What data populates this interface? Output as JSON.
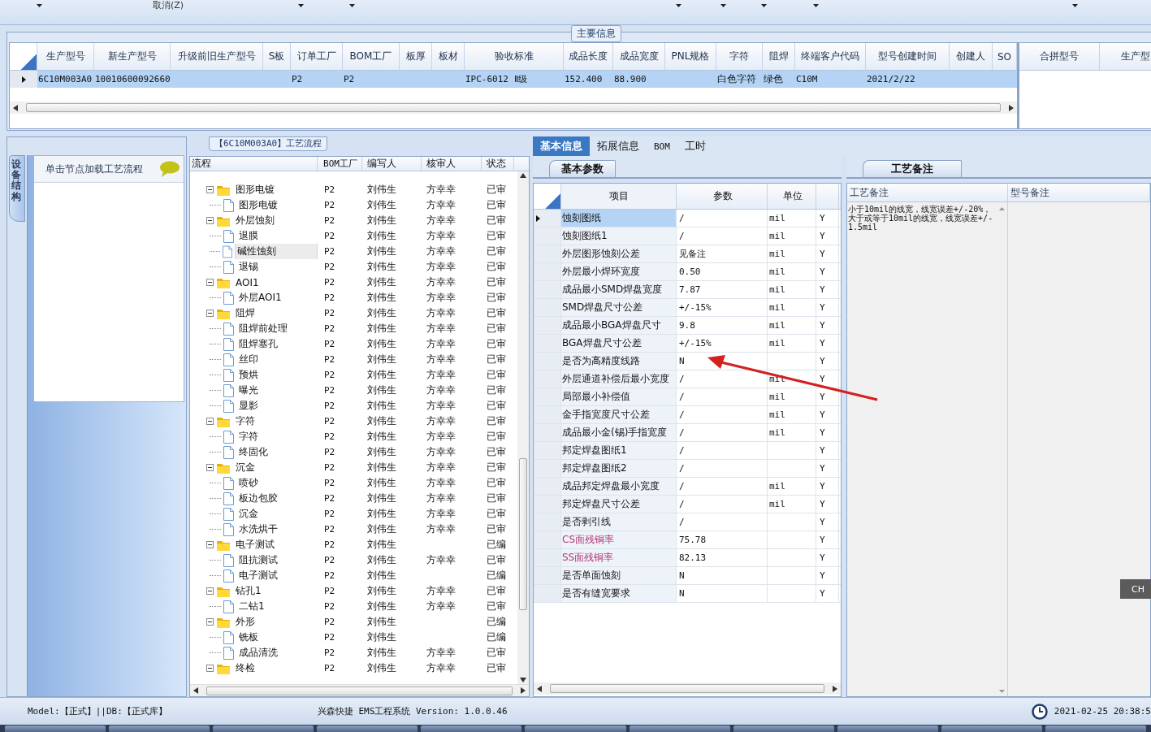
{
  "toolbar": {
    "items": [
      {
        "label": "取消(Z)"
      }
    ]
  },
  "main_info": {
    "title": "主要信息",
    "columns": [
      "生产型号",
      "新生产型号",
      "升级前旧生产型号",
      "S板",
      "订单工厂",
      "BOM工厂",
      "板厚",
      "板材",
      "验收标准",
      "成品长度",
      "成品宽度",
      "PNL规格",
      "字符",
      "阻焊",
      "终端客户代码",
      "型号创建时间",
      "创建人",
      "SO"
    ],
    "rows": [
      {
        "selected": true,
        "cells": [
          "6C10M003A0",
          "10010600092660",
          null,
          null,
          "P2",
          "P2",
          null,
          null,
          "IPC-6012 Ⅱ级",
          "152.400",
          "88.900",
          null,
          "白色字符",
          "绿色",
          "C10M",
          "2021/2/22",
          null,
          null
        ]
      }
    ],
    "side_columns": [
      "合拼型号",
      "生产型"
    ]
  },
  "left_panel": {
    "tab": "设备结构",
    "hint": "单击节点加载工艺流程"
  },
  "process": {
    "title": "【6C10M003A0】工艺流程",
    "columns": [
      "流程",
      "BOM工厂",
      "编写人",
      "核审人",
      "状态"
    ],
    "nodes": [
      {
        "label": "图形电镀",
        "bom": "P2",
        "author": "刘伟生",
        "reviewer": "方幸幸",
        "status": "已审",
        "selected": false,
        "expanded": true,
        "children": [
          {
            "label": "图形电镀",
            "bom": "P2",
            "author": "刘伟生",
            "reviewer": "方幸幸",
            "status": "已审",
            "selected": false
          }
        ]
      },
      {
        "label": "外层蚀刻",
        "bom": "P2",
        "author": "刘伟生",
        "reviewer": "方幸幸",
        "status": "已审",
        "selected": false,
        "expanded": true,
        "children": [
          {
            "label": "退膜",
            "bom": "P2",
            "author": "刘伟生",
            "reviewer": "方幸幸",
            "status": "已审",
            "selected": false
          },
          {
            "label": "碱性蚀刻",
            "bom": "P2",
            "author": "刘伟生",
            "reviewer": "方幸幸",
            "status": "已审",
            "selected": true
          },
          {
            "label": "退锡",
            "bom": "P2",
            "author": "刘伟生",
            "reviewer": "方幸幸",
            "status": "已审",
            "selected": false
          }
        ]
      },
      {
        "label": "AOI1",
        "bom": "P2",
        "author": "刘伟生",
        "reviewer": "方幸幸",
        "status": "已审",
        "selected": false,
        "expanded": true,
        "children": [
          {
            "label": "外层AOI1",
            "bom": "P2",
            "author": "刘伟生",
            "reviewer": "方幸幸",
            "status": "已审",
            "selected": false
          }
        ]
      },
      {
        "label": "阻焊",
        "bom": "P2",
        "author": "刘伟生",
        "reviewer": "方幸幸",
        "status": "已审",
        "selected": false,
        "expanded": true,
        "children": [
          {
            "label": "阻焊前处理",
            "bom": "P2",
            "author": "刘伟生",
            "reviewer": "方幸幸",
            "status": "已审",
            "selected": false
          },
          {
            "label": "阻焊塞孔",
            "bom": "P2",
            "author": "刘伟生",
            "reviewer": "方幸幸",
            "status": "已审",
            "selected": false
          },
          {
            "label": "丝印",
            "bom": "P2",
            "author": "刘伟生",
            "reviewer": "方幸幸",
            "status": "已审",
            "selected": false
          },
          {
            "label": "预烘",
            "bom": "P2",
            "author": "刘伟生",
            "reviewer": "方幸幸",
            "status": "已审",
            "selected": false
          },
          {
            "label": "曝光",
            "bom": "P2",
            "author": "刘伟生",
            "reviewer": "方幸幸",
            "status": "已审",
            "selected": false
          },
          {
            "label": "显影",
            "bom": "P2",
            "author": "刘伟生",
            "reviewer": "方幸幸",
            "status": "已审",
            "selected": false
          }
        ]
      },
      {
        "label": "字符",
        "bom": "P2",
        "author": "刘伟生",
        "reviewer": "方幸幸",
        "status": "已审",
        "selected": false,
        "expanded": true,
        "children": [
          {
            "label": "字符",
            "bom": "P2",
            "author": "刘伟生",
            "reviewer": "方幸幸",
            "status": "已审",
            "selected": false
          },
          {
            "label": "终固化",
            "bom": "P2",
            "author": "刘伟生",
            "reviewer": "方幸幸",
            "status": "已审",
            "selected": false
          }
        ]
      },
      {
        "label": "沉金",
        "bom": "P2",
        "author": "刘伟生",
        "reviewer": "方幸幸",
        "status": "已审",
        "selected": false,
        "expanded": true,
        "children": [
          {
            "label": "喷砂",
            "bom": "P2",
            "author": "刘伟生",
            "reviewer": "方幸幸",
            "status": "已审",
            "selected": false
          },
          {
            "label": "板边包胶",
            "bom": "P2",
            "author": "刘伟生",
            "reviewer": "方幸幸",
            "status": "已审",
            "selected": false
          },
          {
            "label": "沉金",
            "bom": "P2",
            "author": "刘伟生",
            "reviewer": "方幸幸",
            "status": "已审",
            "selected": false
          },
          {
            "label": "水洗烘干",
            "bom": "P2",
            "author": "刘伟生",
            "reviewer": "方幸幸",
            "status": "已审",
            "selected": false
          }
        ]
      },
      {
        "label": "电子测试",
        "bom": "P2",
        "author": "刘伟生",
        "status": "已编",
        "selected": false,
        "expanded": true,
        "children": [
          {
            "label": "阻抗测试",
            "bom": "P2",
            "author": "刘伟生",
            "reviewer": "方幸幸",
            "status": "已审",
            "selected": false
          },
          {
            "label": "电子测试",
            "bom": "P2",
            "author": "刘伟生",
            "status": "已编",
            "selected": false
          }
        ]
      },
      {
        "label": "钻孔1",
        "bom": "P2",
        "author": "刘伟生",
        "reviewer": "方幸幸",
        "status": "已审",
        "selected": false,
        "expanded": true,
        "children": [
          {
            "label": "二钻1",
            "bom": "P2",
            "author": "刘伟生",
            "reviewer": "方幸幸",
            "status": "已审",
            "selected": false
          }
        ]
      },
      {
        "label": "外形",
        "bom": "P2",
        "author": "刘伟生",
        "status": "已编",
        "selected": false,
        "expanded": true,
        "children": [
          {
            "label": "铣板",
            "bom": "P2",
            "author": "刘伟生",
            "status": "已编",
            "selected": false
          },
          {
            "label": "成品清洗",
            "bom": "P2",
            "author": "刘伟生",
            "reviewer": "方幸幸",
            "status": "已审",
            "selected": false
          }
        ]
      },
      {
        "label": "终检",
        "bom": "P2",
        "author": "刘伟生",
        "reviewer": "方幸幸",
        "status": "已审",
        "selected": false,
        "expanded": true
      }
    ]
  },
  "detail_tabs": [
    {
      "label": "基本信息",
      "selected": true
    },
    {
      "label": "拓展信息",
      "selected": false
    },
    {
      "label": "BOM",
      "selected": false
    },
    {
      "label": "工时",
      "selected": false
    }
  ],
  "params": {
    "tab": "基本参数",
    "columns": [
      "项目",
      "参数",
      "单位"
    ],
    "rows": [
      {
        "item": "蚀刻图纸",
        "value": "/",
        "unit": "mil",
        "flag": "Y",
        "selected": true
      },
      {
        "item": "蚀刻图纸1",
        "value": "/",
        "unit": "mil",
        "flag": "Y",
        "selected": false
      },
      {
        "item": "外层图形蚀刻公差",
        "value": "见备注",
        "unit": "mil",
        "flag": "Y",
        "selected": false
      },
      {
        "item": "外层最小焊环宽度",
        "value": "0.50",
        "unit": "mil",
        "flag": "Y",
        "selected": false
      },
      {
        "item": "成品最小SMD焊盘宽度",
        "value": "7.87",
        "unit": "mil",
        "flag": "Y",
        "selected": false
      },
      {
        "item": "SMD焊盘尺寸公差",
        "value": "+/-15%",
        "unit": "mil",
        "flag": "Y",
        "selected": false
      },
      {
        "item": "成品最小BGA焊盘尺寸",
        "value": "9.8",
        "unit": "mil",
        "flag": "Y",
        "selected": false
      },
      {
        "item": "BGA焊盘尺寸公差",
        "value": "+/-15%",
        "unit": "mil",
        "flag": "Y",
        "selected": false
      },
      {
        "item": "是否为高精度线路",
        "value": "N",
        "flag": "Y",
        "selected": false
      },
      {
        "item": "外层通道补偿后最小宽度",
        "value": "/",
        "unit": "mil",
        "flag": "Y",
        "selected": false
      },
      {
        "item": "局部最小补偿值",
        "value": "/",
        "unit": "mil",
        "flag": "Y",
        "selected": false
      },
      {
        "item": "金手指宽度尺寸公差",
        "value": "/",
        "unit": "mil",
        "flag": "Y",
        "selected": false
      },
      {
        "item": "成品最小金(锡)手指宽度",
        "value": "/",
        "unit": "mil",
        "flag": "Y",
        "selected": false
      },
      {
        "item": "邦定焊盘图纸1",
        "value": "/",
        "flag": "Y",
        "selected": false
      },
      {
        "item": "邦定焊盘图纸2",
        "value": "/",
        "flag": "Y",
        "selected": false
      },
      {
        "item": "成品邦定焊盘最小宽度",
        "value": "/",
        "unit": "mil",
        "flag": "Y",
        "selected": false
      },
      {
        "item": "邦定焊盘尺寸公差",
        "value": "/",
        "unit": "mil",
        "flag": "Y",
        "selected": false
      },
      {
        "item": "是否剥引线",
        "value": "/",
        "flag": "Y",
        "selected": false
      },
      {
        "item": "CS面残铜率",
        "value": "75.78",
        "flag": "Y",
        "selected": false,
        "color": "#b03a78"
      },
      {
        "item": "SS面残铜率",
        "value": "82.13",
        "flag": "Y",
        "selected": false,
        "color": "#b03a78"
      },
      {
        "item": "是否单面蚀刻",
        "value": "N",
        "flag": "Y",
        "selected": false
      },
      {
        "item": "是否有缝宽要求",
        "value": "N",
        "flag": "Y",
        "selected": false
      }
    ]
  },
  "notes": {
    "tab": "工艺备注",
    "columns": [
      "工艺备注",
      "型号备注"
    ],
    "process_note": "小于10mil的线宽，线宽误差+/-20%，大于或等于10mil的线宽，线宽误差+/-1.5mil"
  },
  "language_bar": {
    "label": "CH"
  },
  "status_bar": {
    "model": "Model:【正式】||DB:【正式库】",
    "app": "兴森快捷 EMS工程系统 Version: 1.0.0.46",
    "time": "2021-02-25 20:38:5"
  }
}
